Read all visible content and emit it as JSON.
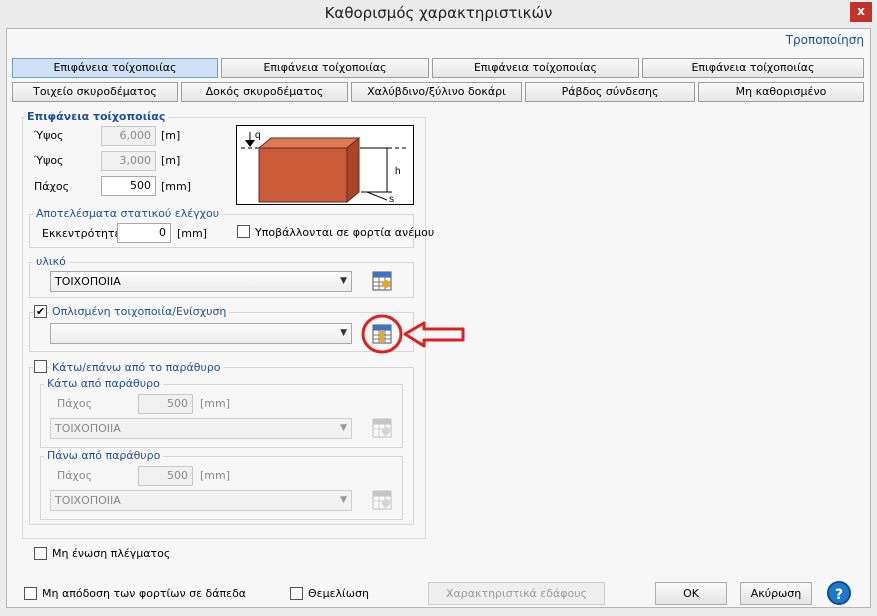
{
  "window": {
    "title": "Καθορισμός χαρακτηριστικών",
    "close_label": "x"
  },
  "header": {
    "modify_label": "Τροποποίηση"
  },
  "tabs_row1": [
    {
      "label": "Επιφάνεια τοίχοποιίας"
    },
    {
      "label": "Επιφάνεια τοίχοποιίας"
    },
    {
      "label": "Επιφάνεια τοίχοποιίας"
    },
    {
      "label": "Επιφάνεια τοίχοποιίας"
    }
  ],
  "tabs_row2": [
    {
      "label": "Τοιχείο σκυροδέματος"
    },
    {
      "label": "Δοκός σκυροδέματος"
    },
    {
      "label": "Χαλύβδινο/ξύλινο δοκάρι"
    },
    {
      "label": "Ράβδος σύνδεσης"
    },
    {
      "label": "Μη καθορισμένο"
    }
  ],
  "surface": {
    "title": "Επιφάνεια τοίχοποιίας",
    "height1_label": "Ύψος",
    "height1_value": "6,000",
    "height1_unit": "[m]",
    "height2_label": "Ύψος",
    "height2_value": "3,000",
    "height2_unit": "[m]",
    "thickness_label": "Πάχος",
    "thickness_value": "500",
    "thickness_unit": "[mm]"
  },
  "preview": {
    "q_label": "q",
    "h_label": "h",
    "s_label": "s"
  },
  "static": {
    "title": "Αποτελέσματα στατικού ελέγχου",
    "ecc_label": "Εκκεντρότητες",
    "ecc_value": "0",
    "ecc_unit": "[mm]",
    "wind_label": "Υποβάλλονται σε φορτία ανέμου"
  },
  "material": {
    "title": "υλικό",
    "value": "ΤΟΙΧΟΠΟΙΙΑ"
  },
  "reinforced": {
    "label": "Οπλισμένη τοιχοποιία/Ενίσχυση",
    "checked": "✔",
    "value": ""
  },
  "window_section": {
    "label": "Κάτω/επάνω από το παράθυρο",
    "below": {
      "title": "Κάτω από παράθυρο",
      "thickness_label": "Πάχος",
      "thickness_value": "500",
      "unit": "[mm]",
      "material": "ΤΟΙΧΟΠΟΙΙΑ"
    },
    "above": {
      "title": "Πάνω από παράθυρο",
      "thickness_label": "Πάχος",
      "thickness_value": "500",
      "unit": "[mm]",
      "material": "ΤΟΙΧΟΠΟΙΙΑ"
    }
  },
  "mesh": {
    "label": "Μη ένωση πλέγματος"
  },
  "footer": {
    "no_load_label": "Μη απόδοση των φορτίων σε δάπεδα",
    "foundation_label": "Θεμελίωση",
    "soil_button": "Χαρακτηριστικά εδάφους",
    "ok_button": "OK",
    "cancel_button": "Ακύρωση",
    "help_label": "?"
  },
  "colors": {
    "accent": "#1e50a0",
    "annotation": "#e02020",
    "brick": "#c95a3a"
  }
}
